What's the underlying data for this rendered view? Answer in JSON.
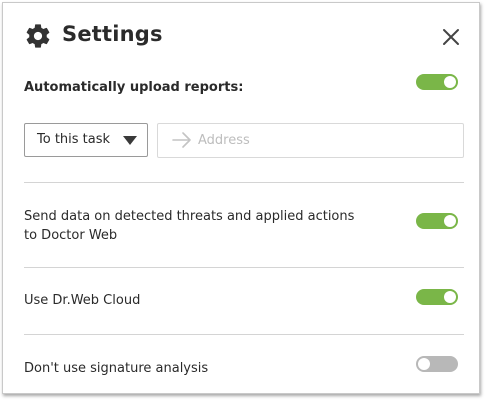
{
  "dialog": {
    "title": "Settings",
    "icons": {
      "title": "gear-icon",
      "close": "close-icon",
      "caret": "caret-down-icon",
      "address": "arrow-right-icon"
    }
  },
  "upload": {
    "label": "Automatically upload reports:",
    "enabled": true,
    "target": {
      "value": "To this task",
      "options": [
        "To this task"
      ]
    },
    "address": {
      "value": "",
      "placeholder": "Address"
    }
  },
  "settings": [
    {
      "label": "Send data on detected threats and applied actions to Doctor Web",
      "enabled": true
    },
    {
      "label": "Use Dr.Web Cloud",
      "enabled": true
    },
    {
      "label": "Don't use signature analysis",
      "enabled": false
    }
  ],
  "colors": {
    "toggle_on": "#7ab648",
    "toggle_off": "#b8b8b8",
    "text": "#2a2a2a"
  }
}
